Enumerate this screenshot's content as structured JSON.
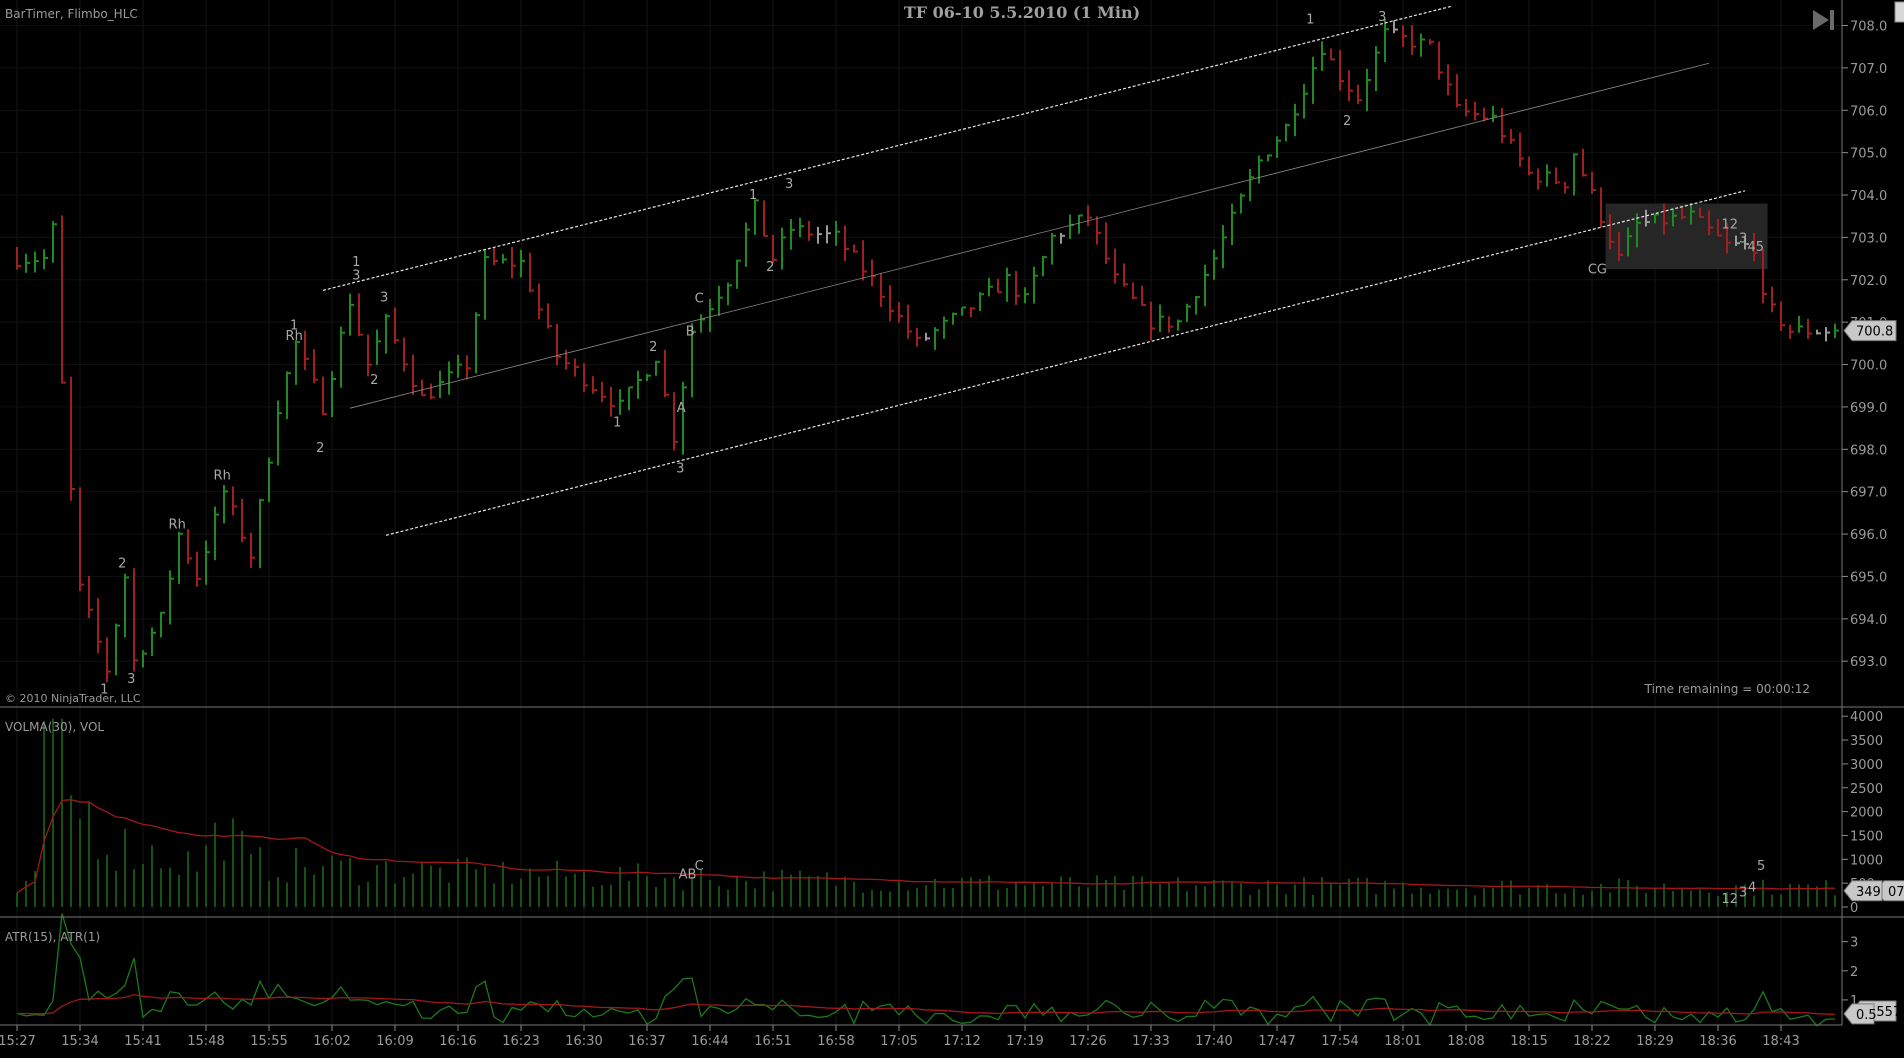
{
  "header": {
    "title": "TF 06-10 5.5.2010 (1 Min)",
    "indicators_label": "BarTimer, Flimbo_HLC",
    "copyright": "© 2010 NinjaTrader, LLC",
    "time_remaining": "Time remaining = 00:00:12",
    "scroll_end_icon": "skip-to-end-icon"
  },
  "colors": {
    "up": "#1f8a1f",
    "down": "#a02020",
    "neutral": "#9a9a9a",
    "volma": "#a01818",
    "atr15": "#a01818",
    "atr1": "#1b7a1b",
    "axis": "#8a8a8a"
  },
  "chart_data": [
    {
      "type": "bar",
      "panel": "price",
      "title": "TF 06-10 5.5.2010 (1 Min)",
      "bar_count": 203,
      "ylim": [
        692.5,
        708.4
      ],
      "yticks": [
        "708.0",
        "707.0",
        "706.0",
        "705.0",
        "704.0",
        "703.0",
        "702.0",
        "701.0",
        "700.0",
        "699.0",
        "698.0",
        "697.0",
        "696.0",
        "695.0",
        "694.0",
        "693.0"
      ],
      "last_price": "700.8",
      "price_path_note": "approximate close path as [bar_index, price]",
      "price_path": [
        [
          0,
          702.5
        ],
        [
          3,
          702.5
        ],
        [
          4,
          703.2
        ],
        [
          5,
          699.5
        ],
        [
          6,
          697
        ],
        [
          7,
          694.7
        ],
        [
          10,
          692.8
        ],
        [
          12,
          695
        ],
        [
          13,
          693
        ],
        [
          16,
          694
        ],
        [
          18,
          696
        ],
        [
          20,
          695
        ],
        [
          23,
          697
        ],
        [
          26,
          695.5
        ],
        [
          29,
          699
        ],
        [
          31,
          700.5
        ],
        [
          34,
          699
        ],
        [
          37,
          701.5
        ],
        [
          39,
          700
        ],
        [
          41,
          701
        ],
        [
          45,
          699.2
        ],
        [
          50,
          700
        ],
        [
          52,
          702.4
        ],
        [
          56,
          702.4
        ],
        [
          60,
          700.2
        ],
        [
          64,
          699.5
        ],
        [
          67,
          699
        ],
        [
          71,
          700.2
        ],
        [
          73,
          698.3
        ],
        [
          75,
          700.8
        ],
        [
          79,
          702
        ],
        [
          82,
          703.7
        ],
        [
          84,
          702.5
        ],
        [
          86,
          703.2
        ],
        [
          91,
          703
        ],
        [
          95,
          702
        ],
        [
          100,
          700.5
        ],
        [
          105,
          701.2
        ],
        [
          110,
          702
        ],
        [
          112,
          701.5
        ],
        [
          115,
          703
        ],
        [
          119,
          703.5
        ],
        [
          122,
          702
        ],
        [
          126,
          701
        ],
        [
          129,
          701
        ],
        [
          133,
          702.5
        ],
        [
          138,
          704.8
        ],
        [
          141,
          705.6
        ],
        [
          145,
          707.5
        ],
        [
          147,
          706.8
        ],
        [
          149,
          706.3
        ],
        [
          152,
          707.8
        ],
        [
          157,
          707.5
        ],
        [
          160,
          706
        ],
        [
          164,
          705.8
        ],
        [
          168,
          704.5
        ],
        [
          172,
          704.3
        ],
        [
          173,
          705
        ],
        [
          176,
          703.5
        ],
        [
          178,
          702.5
        ],
        [
          180,
          703.3
        ],
        [
          186,
          703.5
        ],
        [
          190,
          702.8
        ],
        [
          193,
          702.8
        ],
        [
          194,
          701.5
        ],
        [
          197,
          700.8
        ],
        [
          202,
          700.8
        ]
      ],
      "trendlines": [
        {
          "name": "channel-upper",
          "from": [
            34,
            701.75
          ],
          "to": [
            159.5,
            708.46
          ]
        },
        {
          "name": "channel-middle",
          "from": [
            37,
            698.97
          ],
          "to": [
            188,
            707.11
          ]
        },
        {
          "name": "channel-lower",
          "from": [
            41,
            695.97
          ],
          "to": [
            192,
            704.1
          ]
        }
      ],
      "highlight_box": {
        "from_bar": 176.5,
        "to_bar": 194.5,
        "top": 703.8,
        "bottom": 702.25
      },
      "annotations": [
        {
          "text": "1",
          "bar": 9.7,
          "price": 692.36
        },
        {
          "text": "2",
          "bar": 11.7,
          "price": 695.33
        },
        {
          "text": "3",
          "bar": 12.7,
          "price": 692.6
        },
        {
          "text": "Rh",
          "bar": 17.8,
          "price": 696.25
        },
        {
          "text": "Rh",
          "bar": 22.8,
          "price": 697.4
        },
        {
          "text": "1",
          "bar": 30.8,
          "price": 700.95
        },
        {
          "text": "Rh",
          "bar": 30.8,
          "price": 700.7
        },
        {
          "text": "2",
          "bar": 33.7,
          "price": 698.06
        },
        {
          "text": "1",
          "bar": 37.7,
          "price": 702.44
        },
        {
          "text": "3",
          "bar": 37.7,
          "price": 702.13
        },
        {
          "text": "2",
          "bar": 39.7,
          "price": 699.66
        },
        {
          "text": "3",
          "bar": 40.8,
          "price": 701.6
        },
        {
          "text": "1",
          "bar": 66.7,
          "price": 698.66
        },
        {
          "text": "2",
          "bar": 70.7,
          "price": 700.44
        },
        {
          "text": "A",
          "bar": 73.8,
          "price": 699.0
        },
        {
          "text": "3",
          "bar": 73.7,
          "price": 697.57
        },
        {
          "text": "B",
          "bar": 74.8,
          "price": 700.8
        },
        {
          "text": "C",
          "bar": 75.8,
          "price": 701.58
        },
        {
          "text": "1",
          "bar": 81.8,
          "price": 704.02
        },
        {
          "text": "2",
          "bar": 83.7,
          "price": 702.33
        },
        {
          "text": "3",
          "bar": 85.8,
          "price": 704.28
        },
        {
          "text": "1",
          "bar": 143.7,
          "price": 708.17
        },
        {
          "text": "2",
          "bar": 147.8,
          "price": 705.77
        },
        {
          "text": "3",
          "bar": 151.7,
          "price": 708.23
        },
        {
          "text": "CG",
          "bar": 175.6,
          "price": 702.27
        },
        {
          "text": "12",
          "bar": 190.3,
          "price": 703.33
        },
        {
          "text": "3",
          "bar": 191.8,
          "price": 703.0
        },
        {
          "text": "45",
          "bar": 193.2,
          "price": 702.8
        }
      ]
    },
    {
      "type": "bar",
      "panel": "volume",
      "title": "VOLMA(30), VOL",
      "ylim": [
        0,
        4000
      ],
      "yticks": [
        "4000",
        "3500",
        "3000",
        "2500",
        "2000",
        "1500",
        "1000",
        "500",
        "0"
      ],
      "volume_path": [
        [
          0,
          300
        ],
        [
          2,
          600
        ],
        [
          3,
          3900
        ],
        [
          4,
          3300
        ],
        [
          5,
          3500
        ],
        [
          6,
          2300
        ],
        [
          8,
          2200
        ],
        [
          10,
          1500
        ],
        [
          14,
          1300
        ],
        [
          20,
          1000
        ],
        [
          23,
          1900
        ],
        [
          26,
          1000
        ],
        [
          50,
          800
        ],
        [
          80,
          650
        ],
        [
          120,
          520
        ],
        [
          200,
          450
        ]
      ],
      "last_labels": [
        "349",
        "07"
      ],
      "annotations": [
        {
          "text": "AB",
          "bar": 74.5,
          "value": 600
        },
        {
          "text": "C",
          "bar": 75.8,
          "value": 780
        },
        {
          "text": "12",
          "bar": 190.3,
          "value": 80
        },
        {
          "text": "3",
          "bar": 191.8,
          "value": 220
        },
        {
          "text": "4",
          "bar": 192.8,
          "value": 320
        },
        {
          "text": "5",
          "bar": 193.8,
          "value": 780
        }
      ]
    },
    {
      "type": "line",
      "panel": "atr",
      "title": "ATR(15), ATR(1)",
      "yticks": [
        "3",
        "2",
        "1"
      ],
      "last_labels": [
        "0.557",
        "0.5"
      ]
    }
  ],
  "time_axis": {
    "labels": [
      "15:27",
      "15:34",
      "15:41",
      "15:48",
      "15:55",
      "16:02",
      "16:09",
      "16:16",
      "16:23",
      "16:30",
      "16:37",
      "16:44",
      "16:51",
      "16:58",
      "17:05",
      "17:12",
      "17:19",
      "17:26",
      "17:33",
      "17:40",
      "17:47",
      "17:54",
      "18:01",
      "18:08",
      "18:15",
      "18:22",
      "18:29",
      "18:36",
      "18:43"
    ],
    "minutes_between_labels": 7
  }
}
